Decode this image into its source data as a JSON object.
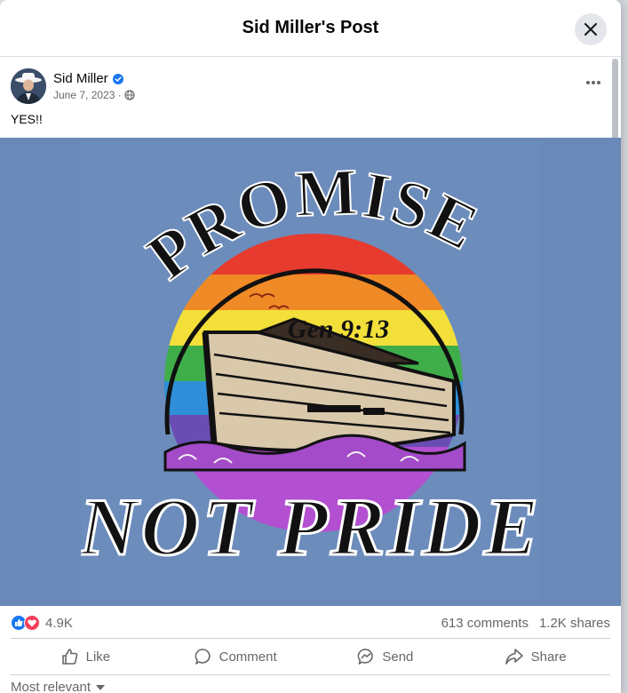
{
  "modal": {
    "title": "Sid Miller's Post",
    "close_icon": "close-icon"
  },
  "post": {
    "author": "Sid Miller",
    "verified_icon": "verified-badge-icon",
    "date": "June 7, 2023 ·",
    "privacy_icon": "globe-icon",
    "more_icon": "more-options-icon",
    "text": "YES!!"
  },
  "image": {
    "top_text": "PROMISE",
    "reference": "Gen 9:13",
    "bottom_text": "NOT PRIDE",
    "background": "#6a89b8",
    "rainbow": [
      "#e63b2e",
      "#f08a26",
      "#f3df3a",
      "#3fae4a",
      "#2f8fd8",
      "#6a4db3",
      "#b34fd1"
    ]
  },
  "stats": {
    "reactions": "4.9K",
    "reaction_icons": [
      "like-reaction-icon",
      "love-reaction-icon"
    ],
    "comments": "613 comments",
    "shares": "1.2K shares"
  },
  "actions": {
    "like": "Like",
    "comment": "Comment",
    "send": "Send",
    "share": "Share"
  },
  "sort": {
    "label": "Most relevant"
  },
  "colors": {
    "accent": "#1877f2",
    "love": "#f33e58",
    "secondary_text": "#65676b"
  }
}
